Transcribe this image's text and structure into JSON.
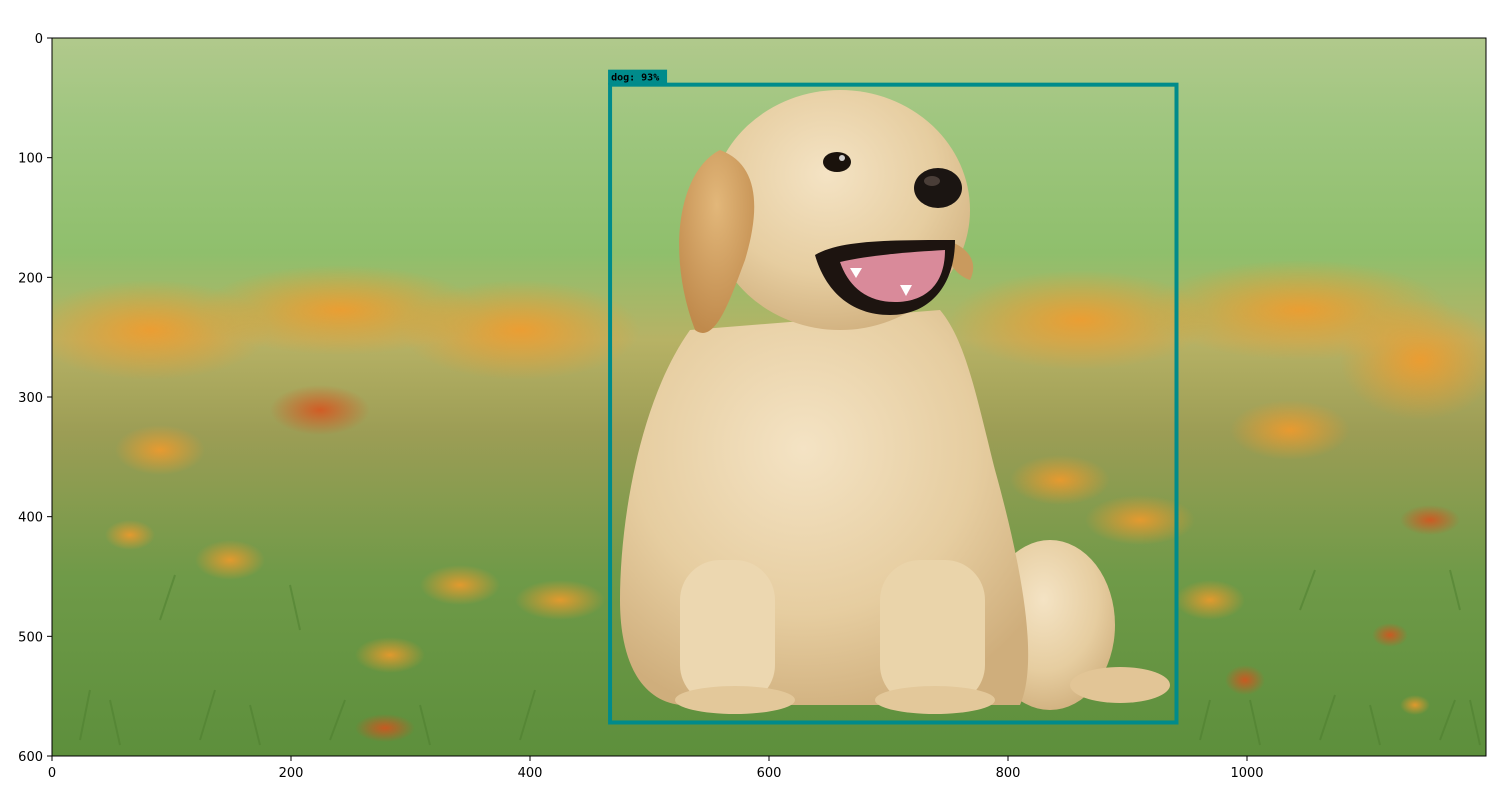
{
  "image": {
    "x_range": [
      0,
      1200
    ],
    "y_range": [
      0,
      600
    ],
    "x_ticks": [
      0,
      200,
      400,
      600,
      800,
      1000
    ],
    "y_ticks": [
      0,
      100,
      200,
      300,
      400,
      500,
      600
    ],
    "content": "golden retriever puppy sitting in grass with scattered orange flowers"
  },
  "detection": {
    "label_text": "dog:  93%",
    "class": "dog",
    "score": 93,
    "box": {
      "xmin": 467,
      "ymin": 39,
      "xmax": 941,
      "ymax": 572
    },
    "color": "#008b8b"
  }
}
